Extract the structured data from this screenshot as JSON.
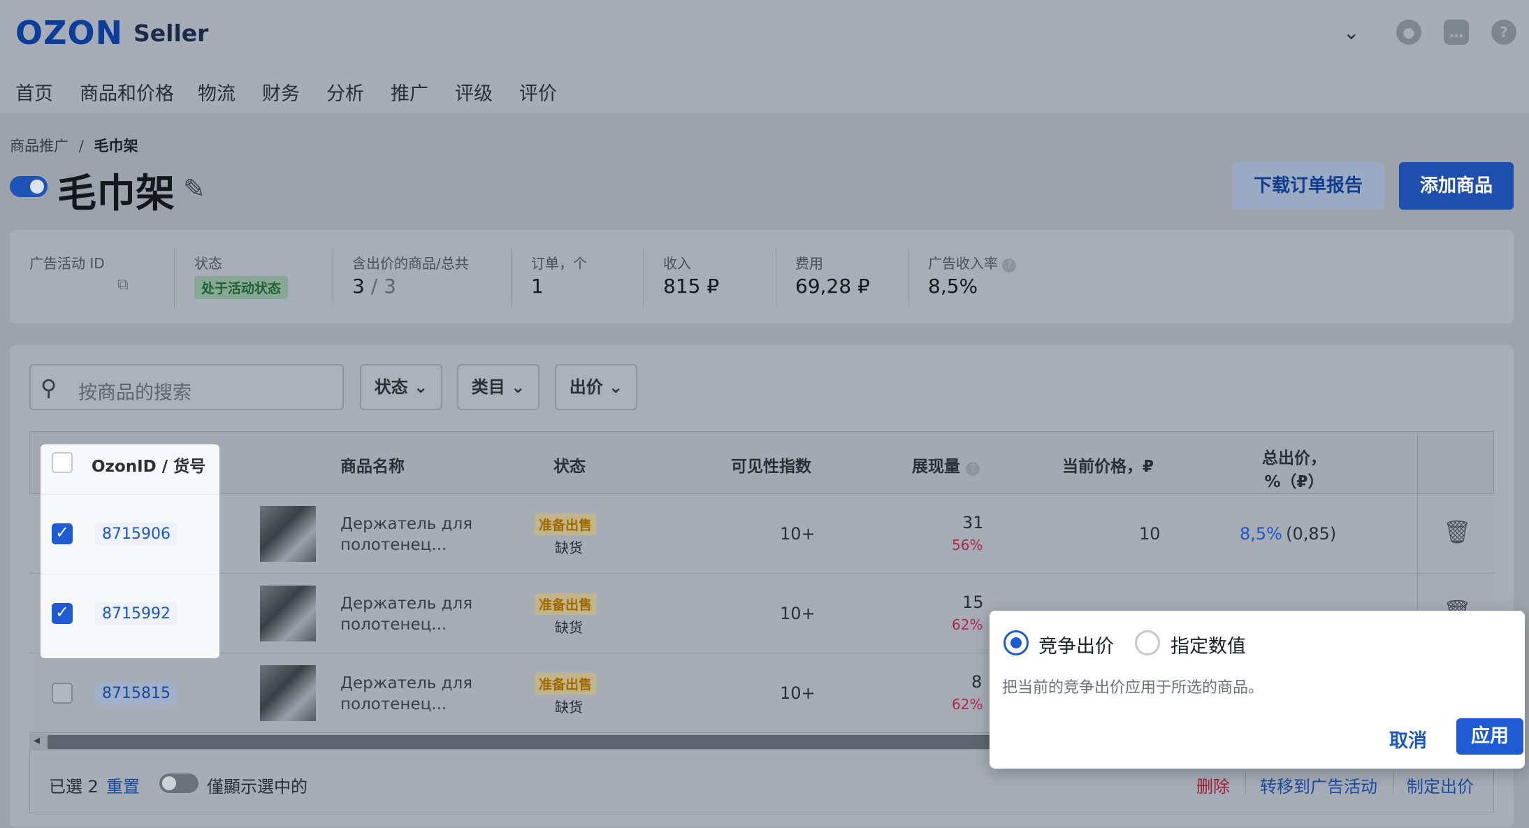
{
  "header": {
    "logo": "OZON",
    "seller": "Seller",
    "nav": [
      "首页",
      "商品和价格",
      "物流",
      "财务",
      "分析",
      "推广",
      "评级",
      "评价"
    ],
    "icons": [
      "chevron-down-icon",
      "user-icon",
      "chat-icon",
      "help-icon"
    ]
  },
  "breadcrumb": {
    "parent": "商品推广",
    "sep": "/",
    "current": "毛巾架"
  },
  "page": {
    "title": "毛巾架",
    "download_btn": "下载订单报告",
    "add_btn": "添加商品"
  },
  "stats": {
    "campaign_id_label": "广告活动 ID",
    "status_label": "状态",
    "status_value": "处于活动状态",
    "products_label": "含出价的商品/总共",
    "products_value": "3",
    "products_total": "/ 3",
    "orders_label": "订单，个",
    "orders_value": "1",
    "revenue_label": "收入",
    "revenue_value": "815 ₽",
    "cost_label": "费用",
    "cost_value": "69,28 ₽",
    "drr_label": "广告收入率",
    "drr_value": "8,5%"
  },
  "filters": {
    "search_placeholder": "按商品的搜索",
    "status": "状态",
    "category": "类目",
    "bid": "出价"
  },
  "table": {
    "headers": {
      "id": "OzonID / 货号",
      "name": "商品名称",
      "status": "状态",
      "visibility": "可见性指数",
      "impressions": "展现量",
      "price": "当前价格，₽",
      "bid_line1": "总出价，",
      "bid_line2": "%（₽）"
    },
    "rows": [
      {
        "id": "8715906",
        "name1": "Держатель для",
        "name2": "полотенец...",
        "status": "准备出售",
        "stock": "缺货",
        "visibility": "10+",
        "impressions": "31",
        "share": "56%",
        "price": "10",
        "bid_pct": "8,5%",
        "bid_abs": "(0,85)",
        "checked": true
      },
      {
        "id": "8715992",
        "name1": "Держатель для",
        "name2": "полотенец...",
        "status": "准备出售",
        "stock": "缺货",
        "visibility": "10+",
        "impressions": "15",
        "share": "62%",
        "checked": true
      },
      {
        "id": "8715815",
        "name1": "Держатель для",
        "name2": "полотенец...",
        "status": "准备出售",
        "stock": "缺货",
        "visibility": "10+",
        "impressions": "8",
        "share": "62%",
        "checked": false
      }
    ]
  },
  "bottom_bar": {
    "selected": "已選 2",
    "reset": "重置",
    "only_selected": "僅顯示選中的",
    "delete": "删除",
    "move": "转移到广告活动",
    "set_bid": "制定出价"
  },
  "popup": {
    "option1": "竞争出价",
    "option2": "指定数值",
    "description": "把当前的竞争出价应用于所选的商品。",
    "cancel": "取消",
    "apply": "应用"
  },
  "colors": {
    "brand": "#1e5ad2",
    "logo": "#0b3e9a",
    "danger": "#b0264a"
  }
}
